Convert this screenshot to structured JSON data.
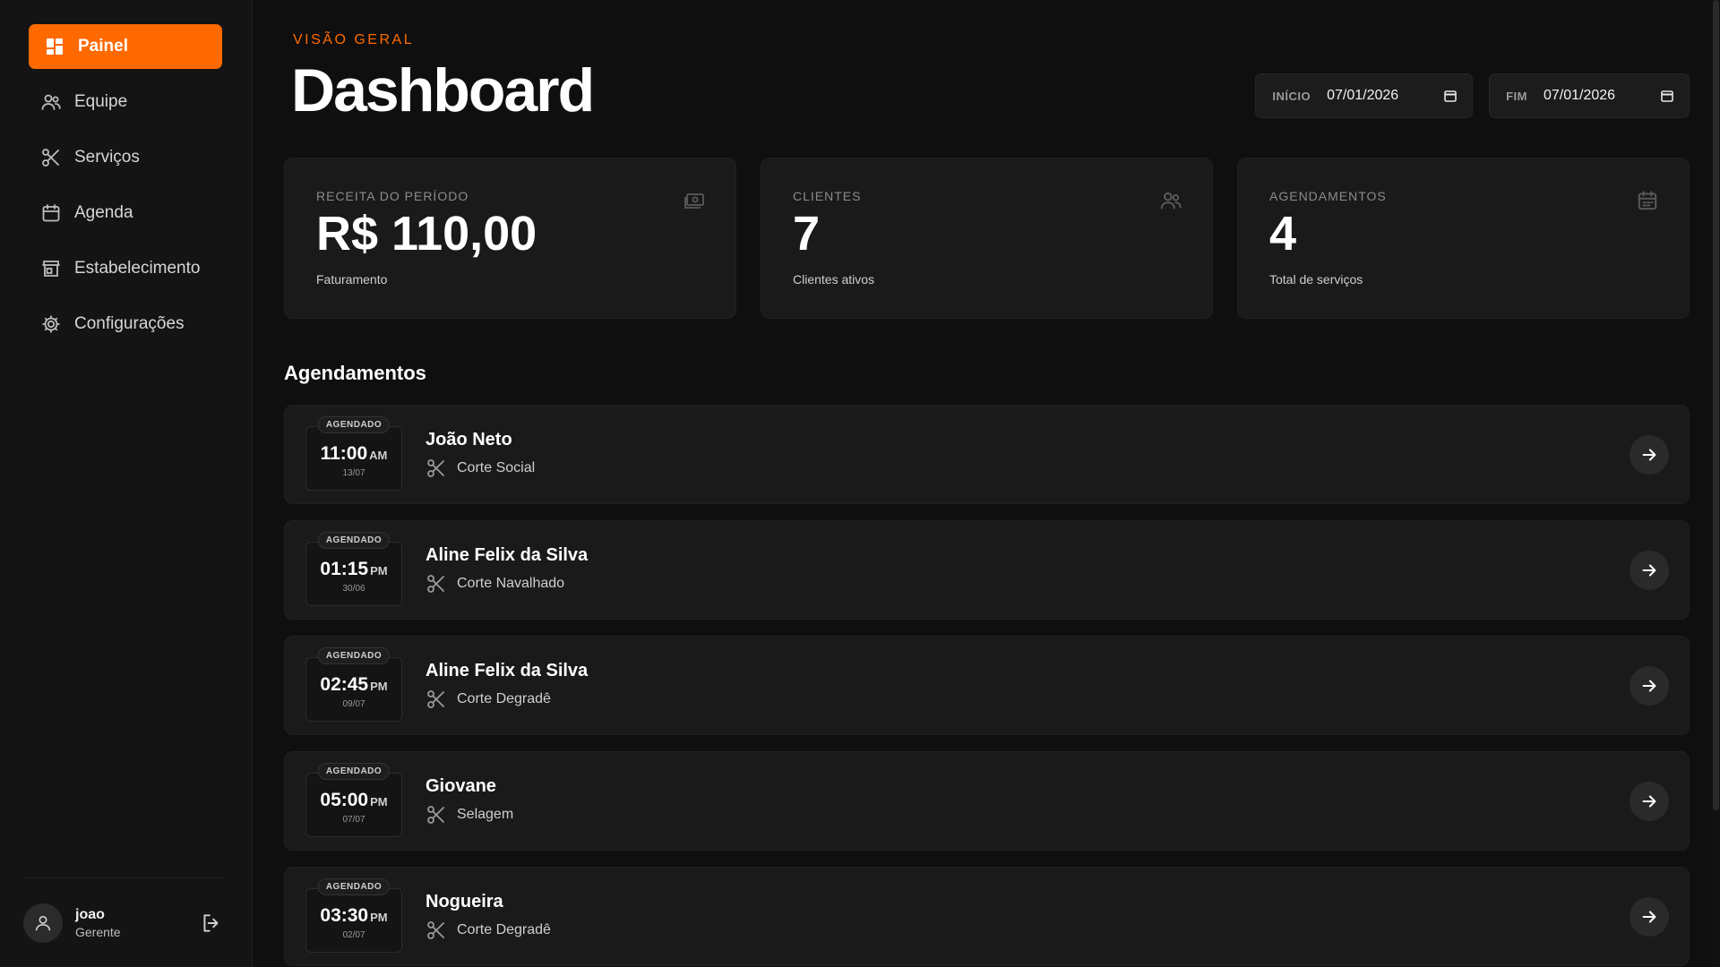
{
  "sidebar": {
    "items": [
      {
        "label": "Painel",
        "icon": "dashboard-icon",
        "active": true
      },
      {
        "label": "Equipe",
        "icon": "users-icon"
      },
      {
        "label": "Serviços",
        "icon": "scissors-icon"
      },
      {
        "label": "Agenda",
        "icon": "calendar-icon"
      },
      {
        "label": "Estabelecimento",
        "icon": "store-icon"
      },
      {
        "label": "Configurações",
        "icon": "gear-icon"
      }
    ],
    "user": {
      "name": "joao",
      "role": "Gerente"
    }
  },
  "header": {
    "eyebrow": "VISÃO GERAL",
    "title": "Dashboard",
    "start_label": "INÍCIO",
    "start_value": "07/01/2026",
    "end_label": "FIM",
    "end_value": "07/01/2026"
  },
  "stats": [
    {
      "label": "RECEITA DO PERÍODO",
      "value": "R$ 110,00",
      "sub": "Faturamento",
      "icon": "money-icon"
    },
    {
      "label": "CLIENTES",
      "value": "7",
      "sub": "Clientes ativos",
      "icon": "users-icon"
    },
    {
      "label": "AGENDAMENTOS",
      "value": "4",
      "sub": "Total de serviços",
      "icon": "calendar-icon"
    }
  ],
  "appointments_title": "Agendamentos",
  "appointments": [
    {
      "status": "AGENDADO",
      "time": "11:00",
      "ampm": "AM",
      "date": "13/07",
      "client": "João Neto",
      "service": "Corte Social"
    },
    {
      "status": "AGENDADO",
      "time": "01:15",
      "ampm": "PM",
      "date": "30/06",
      "client": "Aline Felix da Silva",
      "service": "Corte Navalhado"
    },
    {
      "status": "AGENDADO",
      "time": "02:45",
      "ampm": "PM",
      "date": "09/07",
      "client": "Aline Felix da Silva",
      "service": "Corte Degradê"
    },
    {
      "status": "AGENDADO",
      "time": "05:00",
      "ampm": "PM",
      "date": "07/07",
      "client": "Giovane",
      "service": "Selagem"
    },
    {
      "status": "AGENDADO",
      "time": "03:30",
      "ampm": "PM",
      "date": "02/07",
      "client": "Nogueira",
      "service": "Corte Degradê"
    }
  ],
  "colors": {
    "accent": "#ff6a00",
    "background": "#0f0f0f",
    "card": "#1a1a1a"
  }
}
